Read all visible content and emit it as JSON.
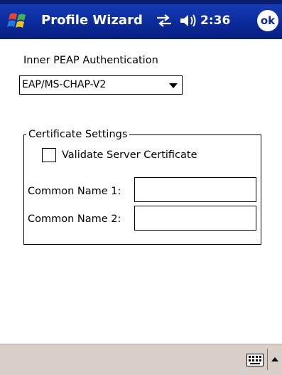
{
  "header": {
    "title": "Profile Wizard",
    "time": "2:36",
    "ok_label": "ok",
    "icons": [
      "windows-start-icon",
      "connectivity-icon",
      "volume-icon"
    ]
  },
  "auth": {
    "label": "Inner PEAP Authentication",
    "selected": "EAP/MS-CHAP-V2"
  },
  "certificate": {
    "group_label": "Certificate Settings",
    "validate_label": "Validate Server Certificate",
    "validate_checked": false,
    "common_name_1_label": "Common Name 1:",
    "common_name_1_value": "",
    "common_name_2_label": "Common Name 2:",
    "common_name_2_value": ""
  },
  "bottom_bar": {
    "icons": [
      "keyboard-icon",
      "sip-arrow-icon"
    ]
  },
  "colors": {
    "titlebar": "#0a2a9a",
    "bottombar": "#d9cfc9"
  }
}
